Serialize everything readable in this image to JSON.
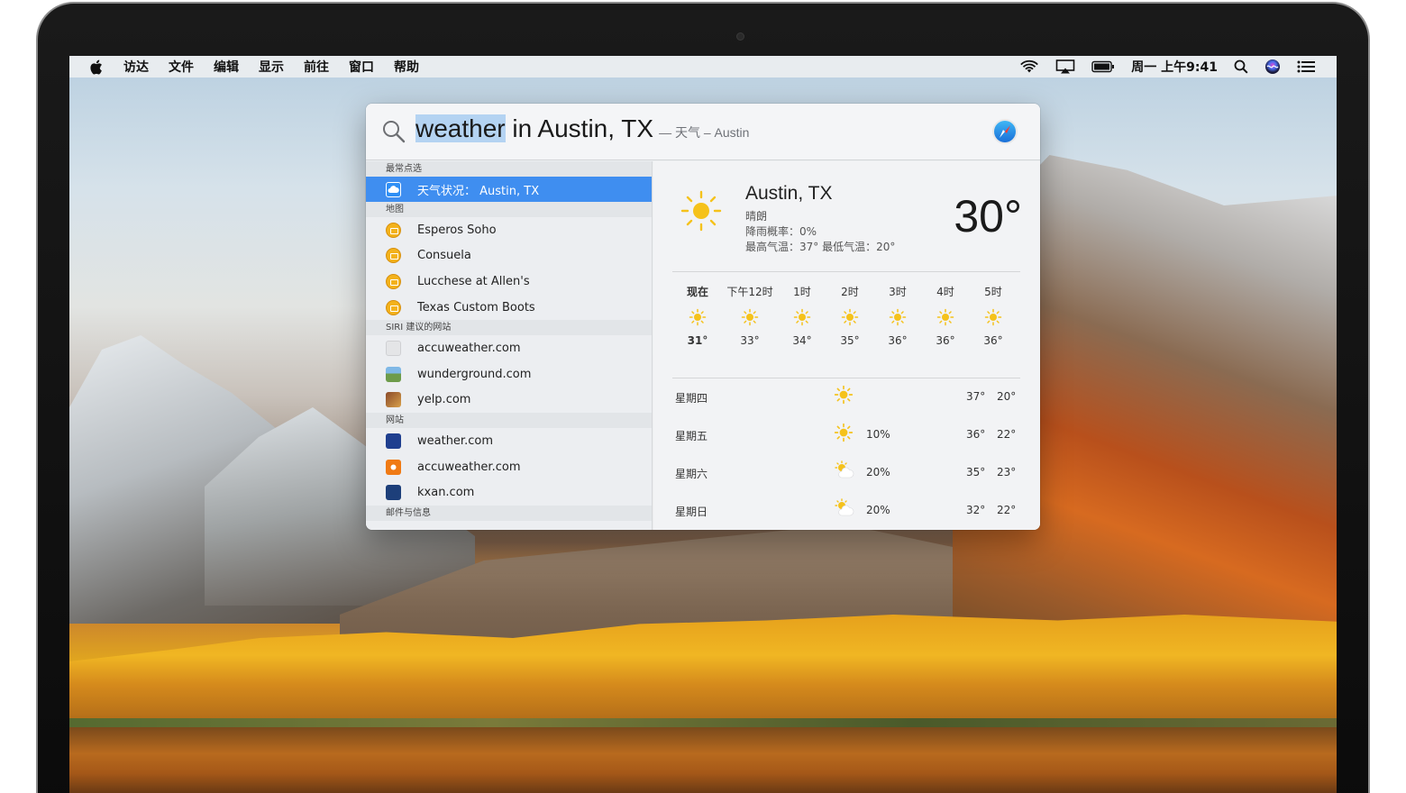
{
  "menubar": {
    "items": [
      "访达",
      "文件",
      "编辑",
      "显示",
      "前往",
      "窗口",
      "帮助"
    ],
    "clock": "周一 上午9:41"
  },
  "search": {
    "query_selected": "weather",
    "query_rest": " in Austin, TX",
    "hint": "— 天气 – Austin"
  },
  "results": {
    "top_hits_header": "最常点选",
    "top_hit": "天气状况： Austin, TX",
    "maps_header": "地图",
    "maps": [
      "Esperos Soho",
      "Consuela",
      "Lucchese at Allen's",
      "Texas Custom Boots"
    ],
    "siri_header": "SIRI 建议的网站",
    "siri_sites": [
      "accuweather.com",
      "wunderground.com",
      "yelp.com"
    ],
    "web_header": "网站",
    "websites": [
      "weather.com",
      "accuweather.com",
      "kxan.com"
    ],
    "mail_header": "邮件与信息"
  },
  "weather": {
    "city": "Austin, TX",
    "condition": "晴朗",
    "rain_chance": "降雨概率：0%",
    "hi_lo": "最高气温：37° 最低气温：20°",
    "current_temp": "30°",
    "hourly": [
      {
        "label": "现在",
        "temp": "31°"
      },
      {
        "label": "下午12时",
        "temp": "33°"
      },
      {
        "label": "1时",
        "temp": "34°"
      },
      {
        "label": "2时",
        "temp": "35°"
      },
      {
        "label": "3时",
        "temp": "36°"
      },
      {
        "label": "4时",
        "temp": "36°"
      },
      {
        "label": "5时",
        "temp": "36°"
      }
    ],
    "daily": [
      {
        "day": "星期四",
        "icon": "sun-icon",
        "rain": "",
        "hi": "37°",
        "lo": "20°"
      },
      {
        "day": "星期五",
        "icon": "sun-icon",
        "rain": "10%",
        "hi": "36°",
        "lo": "22°"
      },
      {
        "day": "星期六",
        "icon": "partly-cloudy-icon",
        "rain": "20%",
        "hi": "35°",
        "lo": "23°"
      },
      {
        "day": "星期日",
        "icon": "partly-cloudy-icon",
        "rain": "20%",
        "hi": "32°",
        "lo": "22°"
      }
    ]
  },
  "colors": {
    "selection": "#3f8ef0",
    "query_highlight": "#b4d3f2",
    "sun": "#f5c21b"
  }
}
